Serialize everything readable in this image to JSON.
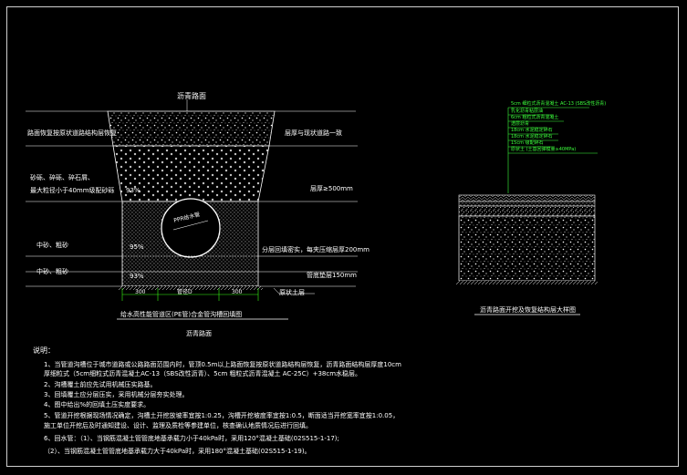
{
  "left_diagram": {
    "top_label": "沥青路面",
    "left_labels": [
      "路面恢复按原状道路结构层恢复",
      "砂砾、碎砾、碎石屑、",
      "最大粒径小于40mm级配砂砾",
      "中砂、粗砂",
      "中砂、粗砂"
    ],
    "right_labels": [
      "层厚与现状道路一致",
      "层厚≥500mm",
      "分层回填密实，每夹压缩层厚200mm",
      "管底垫层150mm",
      "原状土层"
    ],
    "compaction": [
      "93%",
      "95%",
      "93%"
    ],
    "pipe_label": "PPR给水管",
    "dims": [
      "300",
      "管径D",
      "300"
    ],
    "title": "给水高性能管道区(PE管)合金管沟槽回填图",
    "subtitle": "沥青路面"
  },
  "right_diagram": {
    "title": "沥青路面开挖及恢复结构层大样图",
    "layer_labels": [
      "5cm 细粒式沥青混凝土 AC-13 (SBS改性沥青)",
      "乳化沥青粘层油",
      "6cm 粗粒式沥青混凝土",
      "透层沥青",
      "18cm 水泥稳定碎石",
      "18cm 水泥稳定碎石",
      "15cm 级配碎石",
      "原状土 (土基回弹模量≥40MPa)"
    ]
  },
  "notes": {
    "heading": "说明：",
    "lines": [
      "1、当管道沟槽位于城市道路或公路路面范围内时，管顶0.5m以上路面恢复按原状道路结构层恢复，沥青路面结构层厚度10cm",
      "   厚细粒式（5cm细粒式沥青混凝土AC-13（SBS改性沥青）、5cm 粗粒式沥青混凝土 AC-25C）+38cm水稳层。",
      "2、沟槽覆土前应先试用机械压实路基。",
      "3、回填覆土应分层压实，采用机械分层夯实处理。",
      "4、图中给出%的回填土压实度要求。",
      "5、管道开挖根据现场情况确定，沟槽土开挖放坡率宜按1:0.25，沟槽开挖坡度率宜按1:0.5，断面适当开挖宽率宜按1:0.05，",
      "   施工单位开挖后及时通知建设、设计、监理及质检等参建单位，核查确认地质情况后进行回填。",
      "6、回水管：（1）、当钢筋混凝土管管底地基承载力小于40kPa时，采用120°混凝土基础(02S515-1-17);",
      "           （2）、当钢筋混凝土管管底地基承载力大于40kPa时，采用180°混凝土基础(02S515-1-19)。"
    ]
  },
  "colors": {
    "background": "#000000",
    "line": "#ffffff",
    "green": "#3cff3c",
    "dim_green": "#39ff14"
  }
}
